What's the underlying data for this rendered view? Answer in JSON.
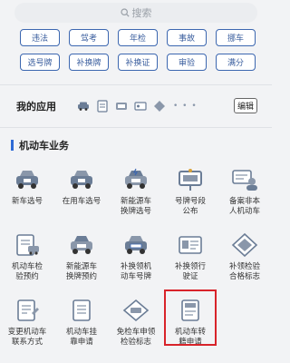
{
  "search": {
    "label": "搜索"
  },
  "tags": [
    [
      "违法",
      "驾考",
      "年检",
      "事故",
      "挪车"
    ],
    [
      "选号牌",
      "补换牌",
      "补换证",
      "审验",
      "满分"
    ]
  ],
  "my_apps": {
    "title": "我的应用",
    "more": "• • •",
    "edit_label": "编辑"
  },
  "section": {
    "title": "机动车业务"
  },
  "services": [
    [
      {
        "label": "新车选号",
        "icon": "car-number-icon"
      },
      {
        "label": "在用车选号",
        "icon": "car-number-icon"
      },
      {
        "label": "新能源车\n换牌选号",
        "icon": "new-energy-car-icon"
      },
      {
        "label": "号牌号段\n公布",
        "icon": "plate-notice-icon"
      },
      {
        "label": "备案非本\n人机动车",
        "icon": "person-car-icon"
      }
    ],
    [
      {
        "label": "机动车检\n验预约",
        "icon": "inspection-icon"
      },
      {
        "label": "新能源车\n换牌预约",
        "icon": "new-energy-car-icon"
      },
      {
        "label": "补换领机\n动车号牌",
        "icon": "plate-replace-icon"
      },
      {
        "label": "补换领行\n驶证",
        "icon": "license-icon"
      },
      {
        "label": "补领检验\n合格标志",
        "icon": "badge-icon"
      }
    ],
    [
      {
        "label": "变更机动车\n联系方式",
        "icon": "contact-change-icon"
      },
      {
        "label": "机动车挂\n靠申请",
        "icon": "document-icon"
      },
      {
        "label": "免检车申领\n检验标志",
        "icon": "exempt-badge-icon"
      },
      {
        "label": "机动车转\n籍申请",
        "icon": "transfer-icon",
        "highlighted": true
      },
      {
        "label": "",
        "icon": ""
      }
    ]
  ],
  "colors": {
    "accent": "#3c67b0",
    "highlight": "#d8232a"
  }
}
